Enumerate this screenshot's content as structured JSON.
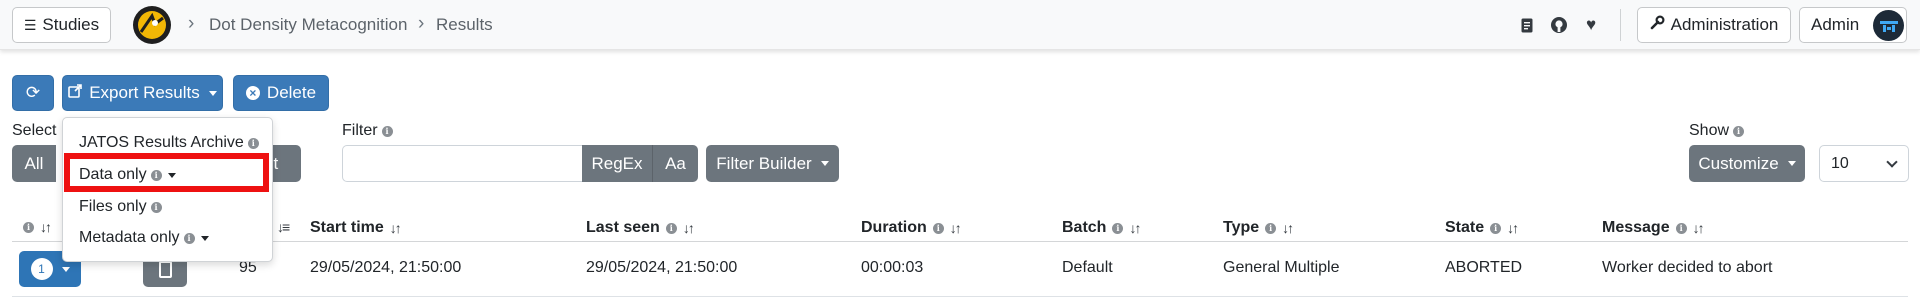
{
  "navbar": {
    "studies_label": "Studies",
    "breadcrumb": [
      "Dot Density Metacognition",
      "Results"
    ],
    "admin_label": "Administration",
    "user_label": "Admin"
  },
  "toolbar": {
    "export_label": "Export Results",
    "delete_label": "Delete"
  },
  "select": {
    "label": "Select",
    "all_label": "All",
    "deselect_tail": "ct"
  },
  "filter": {
    "label": "Filter",
    "input_value": "",
    "regex_label": "RegEx",
    "case_label": "Aa",
    "builder_label": "Filter Builder"
  },
  "show": {
    "label": "Show",
    "customize_label": "Customize",
    "page_size": "10"
  },
  "export_menu": {
    "items": [
      "JATOS Results Archive",
      "Data only",
      "Files only",
      "Metadata only"
    ]
  },
  "table": {
    "partial_header": "lt",
    "headers": [
      "Start time",
      "Last seen",
      "Duration",
      "Batch",
      "Type",
      "State",
      "Message"
    ],
    "rows": [
      {
        "count": "1",
        "id": "95",
        "start_time": "29/05/2024, 21:50:00",
        "last_seen": "29/05/2024, 21:50:00",
        "duration": "00:00:03",
        "batch": "Default",
        "type": "General Multiple",
        "state": "ABORTED",
        "message": "Worker decided to abort"
      }
    ]
  },
  "colors": {
    "primary": "#3b7ab8",
    "secondary": "#6c757d",
    "highlight": "#ee1111"
  },
  "icons": [
    "hamburger-icon",
    "logo-icon",
    "chevron-right-icon",
    "document-icon",
    "github-icon",
    "heart-icon",
    "wrench-icon",
    "refresh-icon",
    "external-link-icon",
    "x-circle-icon",
    "info-icon",
    "sort-icon",
    "sort-descending-icon",
    "checkbox-icon"
  ]
}
